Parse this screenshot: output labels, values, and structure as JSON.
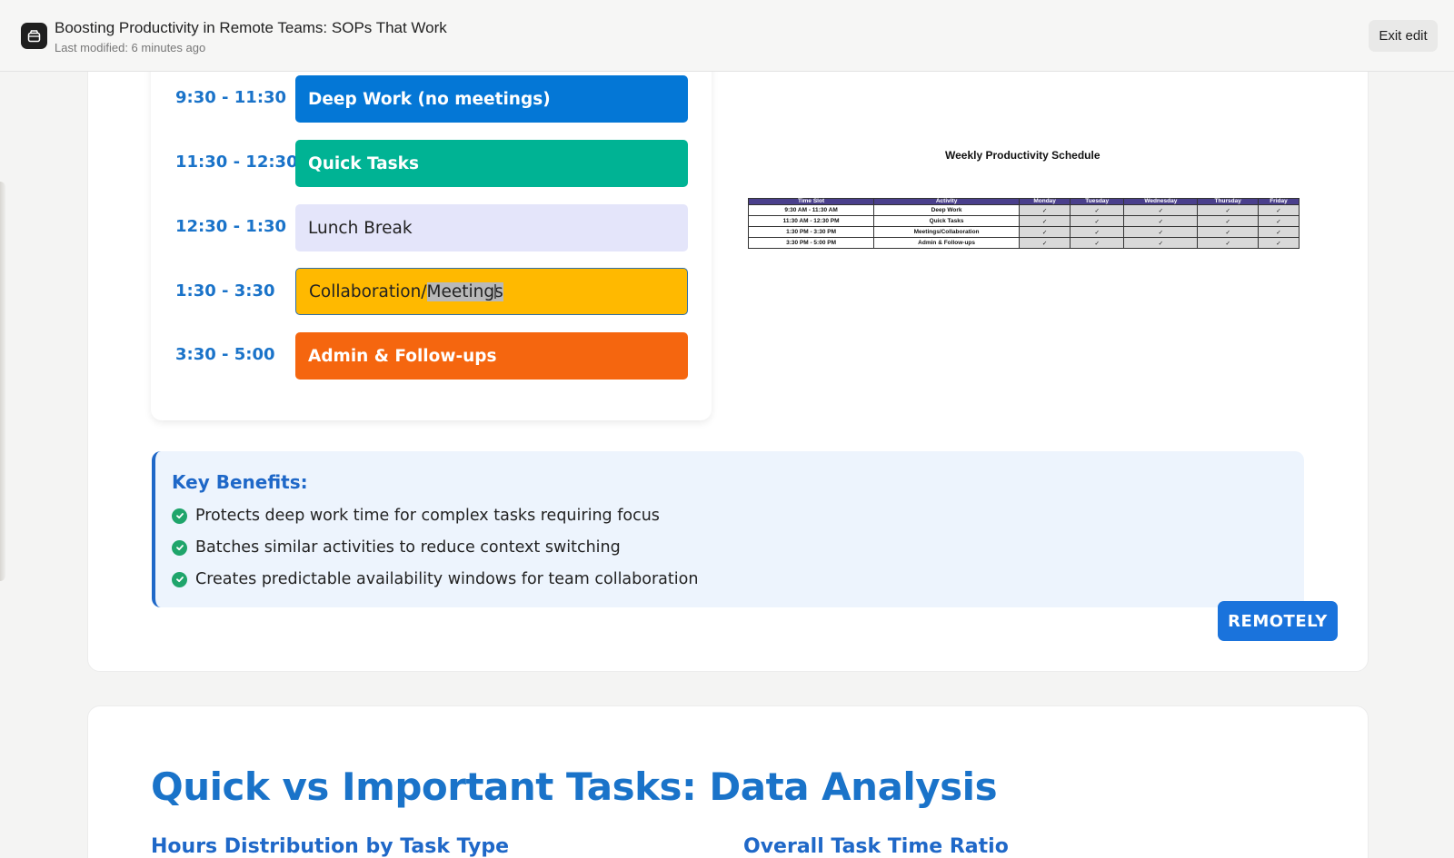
{
  "header": {
    "title": "Boosting Productivity in Remote Teams: SOPs That Work",
    "subtitle": "Last modified: 6 minutes ago",
    "exit_label": "Exit edit"
  },
  "schedule": [
    {
      "time": "9:30 - 11:30",
      "activity": "Deep Work (no meetings)",
      "color": "#0477d6"
    },
    {
      "time": "11:30 - 12:30",
      "activity": "Quick Tasks",
      "color": "#00b394"
    },
    {
      "time": "12:30 - 1:30",
      "activity": "Lunch Break",
      "color": "#e4e5fa"
    },
    {
      "time": "1:30 - 3:30",
      "activity_prefix": "Collaboration/",
      "activity_selected": "Meetings",
      "color": "#ffb900"
    },
    {
      "time": "3:30 - 5:00",
      "activity": "Admin & Follow-ups",
      "color": "#f5660f"
    }
  ],
  "weekly_table": {
    "title": "Weekly Productivity Schedule",
    "headers": [
      "Time Slot",
      "Activity",
      "Monday",
      "Tuesday",
      "Wednesday",
      "Thursday",
      "Friday"
    ],
    "rows": [
      [
        "9:30 AM - 11:30 AM",
        "Deep Work",
        "✓",
        "✓",
        "✓",
        "✓",
        "✓"
      ],
      [
        "11:30 AM - 12:30 PM",
        "Quick Tasks",
        "✓",
        "✓",
        "✓",
        "✓",
        "✓"
      ],
      [
        "1:30 PM - 3:30 PM",
        "Meetings/Collaboration",
        "✓",
        "✓",
        "✓",
        "✓",
        "✓"
      ],
      [
        "3:30 PM - 5:00 PM",
        "Admin & Follow-ups",
        "✓",
        "✓",
        "✓",
        "✓",
        "✓"
      ]
    ]
  },
  "benefits": {
    "title": "Key Benefits:",
    "items": [
      "Protects deep work time for complex tasks requiring focus",
      "Batches similar activities to reduce context switching",
      "Creates predictable availability windows for team collaboration"
    ]
  },
  "remotely_label": "REMOTELY",
  "section": {
    "title": "Quick vs Important Tasks: Data Analysis",
    "left_subtitle": "Hours Distribution by Task Type",
    "right_subtitle": "Overall Task Time Ratio"
  }
}
